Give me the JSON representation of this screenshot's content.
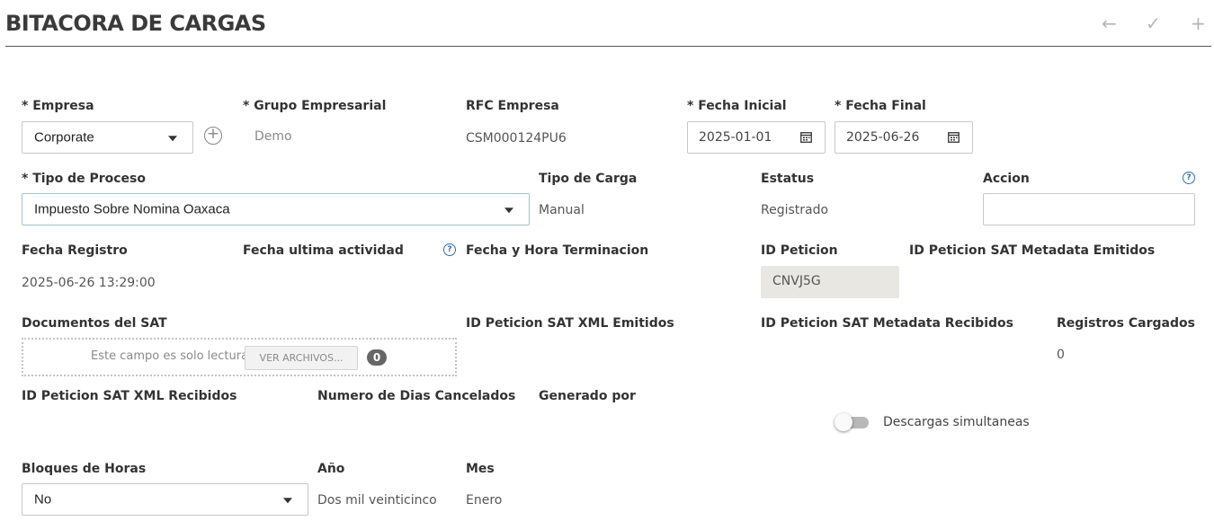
{
  "page": {
    "title": "BITACORA DE CARGAS"
  },
  "toolbar": {
    "back_icon": "arrow-left-icon",
    "save_icon": "check-icon",
    "add_icon": "plus-icon"
  },
  "empresa": {
    "label": "* Empresa",
    "value": "Corporate"
  },
  "grupo": {
    "label": "* Grupo Empresarial",
    "value": "Demo"
  },
  "rfc": {
    "label": "RFC Empresa",
    "value": "CSM000124PU6"
  },
  "fecha_inicial": {
    "label": "* Fecha Inicial",
    "value": "2025-01-01"
  },
  "fecha_final": {
    "label": "* Fecha Final",
    "value": "2025-06-26"
  },
  "tipo_proceso": {
    "label": "* Tipo de Proceso",
    "value": "Impuesto Sobre Nomina Oaxaca"
  },
  "tipo_carga": {
    "label": "Tipo de Carga",
    "value": "Manual"
  },
  "estatus": {
    "label": "Estatus",
    "value": "Registrado"
  },
  "accion": {
    "label": "Accion",
    "value": ""
  },
  "fecha_registro": {
    "label": "Fecha Registro",
    "value": "2025-06-26 13:29:00"
  },
  "fecha_ultima": {
    "label": "Fecha ultima actividad"
  },
  "fecha_hora_term": {
    "label": "Fecha y Hora Terminacion"
  },
  "id_peticion": {
    "label": "ID Peticion",
    "value": "CNVJ5G"
  },
  "id_meta_emitidos": {
    "label": "ID Peticion SAT Metadata Emitidos"
  },
  "documentos": {
    "label": "Documentos del SAT",
    "readonly_text": "Este campo es solo lectura",
    "button": "VER ARCHIVOS...",
    "count": "0"
  },
  "id_xml_emitidos": {
    "label": "ID Peticion SAT XML Emitidos"
  },
  "id_meta_recibidos": {
    "label": "ID Peticion SAT Metadata Recibidos"
  },
  "registros": {
    "label": "Registros Cargados",
    "value": "0"
  },
  "id_xml_recibidos": {
    "label": "ID Peticion SAT XML Recibidos"
  },
  "dias_cancelados": {
    "label": "Numero de Dias Cancelados"
  },
  "generado_por": {
    "label": "Generado por"
  },
  "descargas": {
    "label": "Descargas simultaneas",
    "enabled": false
  },
  "bloques": {
    "label": "Bloques de Horas",
    "value": "No"
  },
  "anio": {
    "label": "Año",
    "value": "Dos mil veinticinco"
  },
  "mes": {
    "label": "Mes",
    "value": "Enero"
  }
}
